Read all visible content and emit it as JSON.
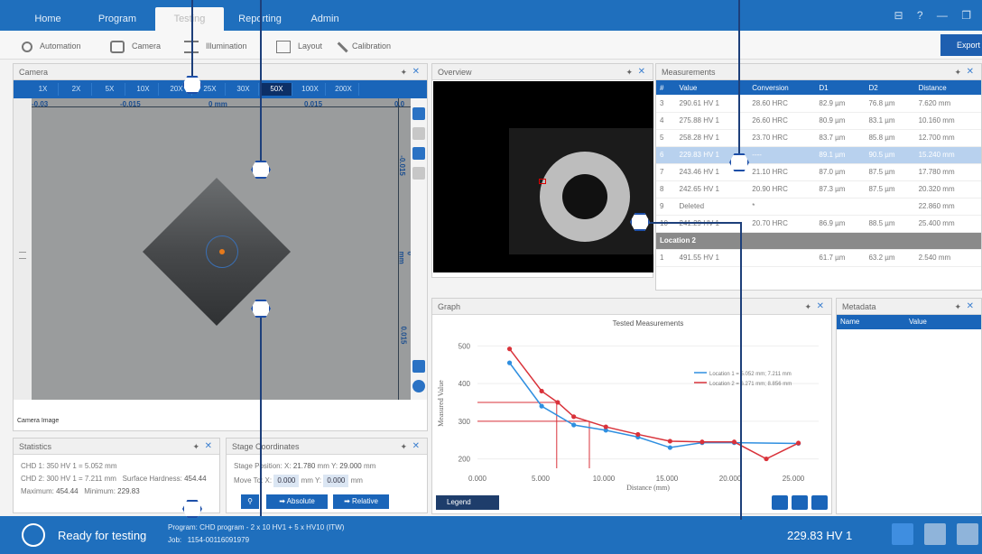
{
  "menubar": {
    "tabs": [
      "Home",
      "Program",
      "Testing",
      "Reporting",
      "Admin"
    ],
    "active": "Testing",
    "window_controls": "⊟ ? — ❐"
  },
  "toolbar": {
    "items": [
      "Automation",
      "Camera",
      "Illumination",
      "Layout",
      "Calibration"
    ],
    "export": "Export"
  },
  "camera": {
    "title": "Camera",
    "zooms": [
      "1X",
      "2X",
      "5X",
      "10X",
      "20X",
      "25X",
      "30X",
      "50X",
      "100X",
      "200X"
    ],
    "selected_zoom": "50X",
    "hruler": [
      "-0.03",
      "-0.015",
      "0 mm",
      "0.015",
      "0.0"
    ],
    "vruler": [
      "-0.015",
      "0 mm",
      "0.015"
    ],
    "tabs": [
      "Camera",
      "Image"
    ]
  },
  "statistics": {
    "title": "Statistics",
    "chd1": "CHD 1: 350 HV 1 = 5.052 mm",
    "chd2": "CHD 2: 300 HV 1 = 7.211 mm",
    "surface_label": "Surface Hardness:",
    "surface_value": "454.44",
    "max_label": "Maximum:",
    "max_value": "454.44",
    "min_label": "Minimum:",
    "min_value": "229.83"
  },
  "stage": {
    "title": "Stage Coordinates",
    "position_label": "Stage Position:",
    "pos_x": "21.780",
    "pos_y": "29.000",
    "unit": "mm",
    "move_label": "Move To:",
    "move_x": "0.000",
    "move_y": "0.000",
    "absolute": "Absolute",
    "relative": "Relative"
  },
  "overview": {
    "title": "Overview"
  },
  "measurements": {
    "title": "Measurements",
    "columns": [
      "#",
      "Value",
      "Conversion",
      "D1",
      "D2",
      "Distance"
    ],
    "rows": [
      [
        "3",
        "290.61 HV 1",
        "28.60 HRC",
        "82.9 µm",
        "76.8 µm",
        "7.620 mm"
      ],
      [
        "4",
        "275.88 HV 1",
        "26.60 HRC",
        "80.9 µm",
        "83.1 µm",
        "10.160 mm"
      ],
      [
        "5",
        "258.28 HV 1",
        "23.70 HRC",
        "83.7 µm",
        "85.8 µm",
        "12.700 mm"
      ],
      [
        "6",
        "229.83 HV 1",
        "----",
        "89.1 µm",
        "90.5 µm",
        "15.240 mm"
      ],
      [
        "7",
        "243.46 HV 1",
        "21.10 HRC",
        "87.0 µm",
        "87.5 µm",
        "17.780 mm"
      ],
      [
        "8",
        "242.65 HV 1",
        "20.90 HRC",
        "87.3 µm",
        "87.5 µm",
        "20.320 mm"
      ],
      [
        "9",
        "Deleted",
        "*",
        "",
        "",
        "22.860 mm"
      ],
      [
        "10",
        "241.29 HV 1",
        "20.70 HRC",
        "86.9 µm",
        "88.5 µm",
        "25.400 mm"
      ]
    ],
    "selected_row": 3,
    "group_label": "Location 2",
    "partial_row": [
      "1",
      "491.55 HV 1",
      "",
      "61.7 µm",
      "63.2 µm",
      "2.540 mm"
    ]
  },
  "graph": {
    "title": "Graph",
    "legend_button": "Legend"
  },
  "metadata": {
    "title": "Metadata",
    "columns": [
      "Name",
      "Value"
    ]
  },
  "chart_data": {
    "type": "line",
    "title": "Tested Measurements",
    "xlabel": "Distance (mm)",
    "ylabel": "Measured Value",
    "xlim": [
      0,
      27
    ],
    "ylim": [
      175,
      520
    ],
    "xticks": [
      "0.000",
      "5.000",
      "10.000",
      "15.000",
      "20.000",
      "25.000"
    ],
    "xtick_values": [
      0,
      5,
      10,
      15,
      20,
      25
    ],
    "yticks": [
      200,
      300,
      400,
      500
    ],
    "series": [
      {
        "name": "Location 1 = 5.052 mm; 7.211 mm",
        "color": "#2f8fe0",
        "x": [
          2.54,
          5.08,
          7.62,
          10.16,
          12.7,
          15.24,
          17.78,
          20.32,
          25.4
        ],
        "y": [
          455,
          340,
          290,
          276,
          258,
          230,
          243,
          243,
          241
        ]
      },
      {
        "name": "Location 2 = 6.271 mm; 8.856 mm",
        "color": "#d9323a",
        "x": [
          2.54,
          5.08,
          6.35,
          7.62,
          10.16,
          12.7,
          15.24,
          17.78,
          20.32,
          22.86,
          25.4
        ],
        "y": [
          492,
          380,
          350,
          312,
          285,
          265,
          247,
          245,
          245,
          200,
          242
        ]
      }
    ],
    "reference_lines": [
      {
        "color": "#d9323a",
        "y": 350,
        "x": 6.271
      },
      {
        "color": "#d9323a",
        "y": 300,
        "x": 8.856
      }
    ],
    "legend_position": "top-right"
  },
  "status": {
    "ready": "Ready for testing",
    "program_label": "Program:",
    "program": "CHD program - 2 x 10 HV1 + 5 x HV10 (ITW)",
    "job_label": "Job:",
    "job": "1154-00116091979",
    "reading": "229.83 HV 1"
  }
}
